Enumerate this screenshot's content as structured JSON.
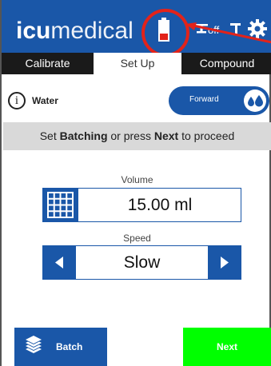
{
  "header": {
    "logo_bold": "icu",
    "logo_light": "medical",
    "power_status": "off",
    "brand_color": "#1a57a8"
  },
  "tabs": [
    {
      "label": "Calibrate",
      "active": false
    },
    {
      "label": "Set Up",
      "active": true
    },
    {
      "label": "Compound",
      "active": false
    }
  ],
  "fluid": {
    "name": "Water",
    "direction_label": "Forward"
  },
  "banner": {
    "prefix": "Set ",
    "bold1": "Batching",
    "middle": " or press ",
    "bold2": "Next",
    "suffix": " to proceed"
  },
  "volume": {
    "label": "Volume",
    "value": "15.00 ml"
  },
  "speed": {
    "label": "Speed",
    "value": "Slow"
  },
  "footer": {
    "batch_label": "Batch",
    "next_label": "Next",
    "next_color": "#00ff00"
  },
  "icons": [
    "battery-icon",
    "plug-icon",
    "faucet-icon",
    "gear-icon",
    "info-icon",
    "droplet-icon",
    "keypad-icon",
    "arrow-left-icon",
    "arrow-right-icon",
    "layers-icon"
  ]
}
